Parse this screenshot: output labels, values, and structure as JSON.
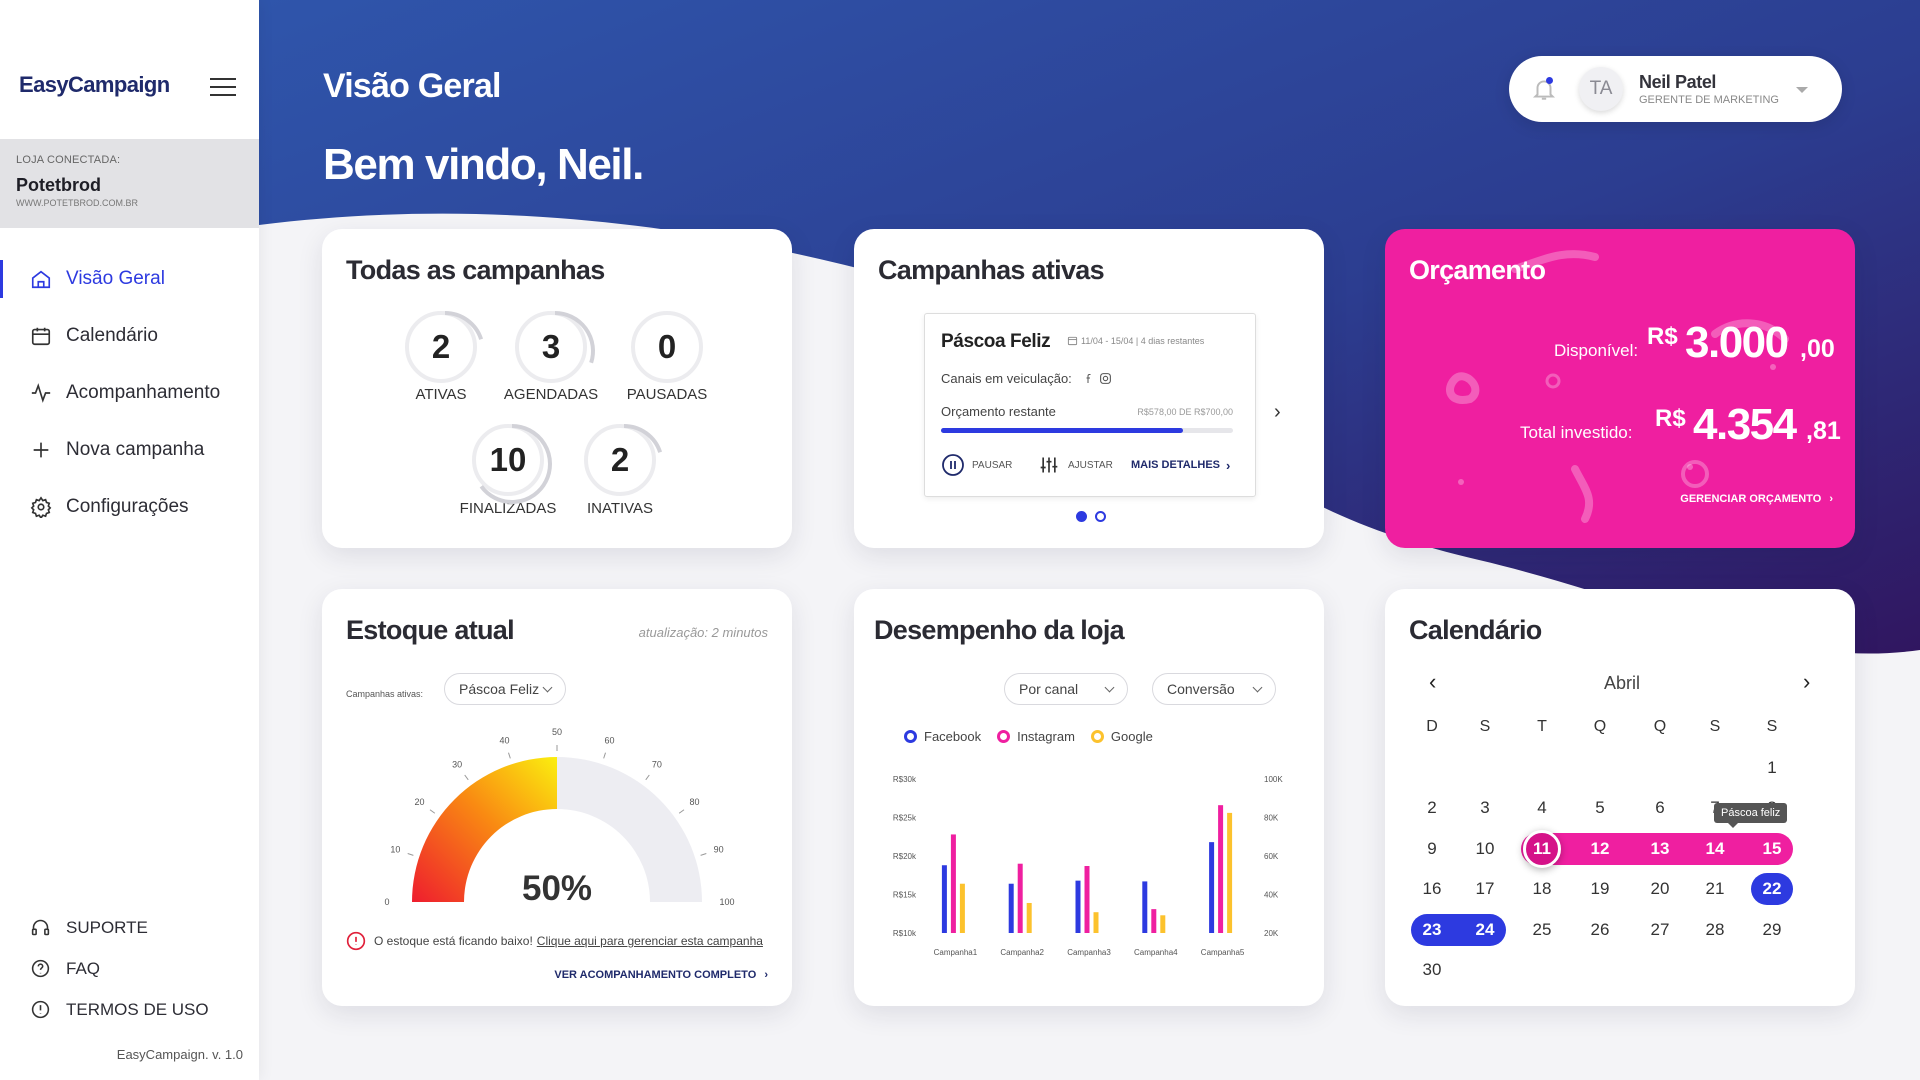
{
  "sidebar": {
    "logo": "EasyCampaign",
    "store_label": "LOJA CONECTADA:",
    "store_name": "Potetbrod",
    "store_url": "WWW.POTETBROD.COM.BR",
    "items": [
      {
        "label": "Visão Geral",
        "icon": "home-icon",
        "active": true
      },
      {
        "label": "Calendário",
        "icon": "calendar-icon"
      },
      {
        "label": "Acompanhamento",
        "icon": "activity-icon"
      },
      {
        "label": "Nova campanha",
        "icon": "plus-icon"
      },
      {
        "label": "Configurações",
        "icon": "gear-icon"
      }
    ],
    "footer": [
      {
        "label": "SUPORTE",
        "icon": "headset-icon"
      },
      {
        "label": "FAQ",
        "icon": "question-icon"
      },
      {
        "label": "TERMOS DE USO",
        "icon": "info-icon"
      }
    ],
    "version": "EasyCampaign. v. 1.0"
  },
  "header": {
    "title": "Visão Geral",
    "welcome": "Bem vindo, Neil.",
    "avatar_initials": "TA",
    "user_name": "Neil Patel",
    "user_role": "GERENTE DE MARKETING"
  },
  "all_campaigns": {
    "title": "Todas as campanhas",
    "stats": [
      {
        "value": "2",
        "label": "ATIVAS",
        "progress": 0.2
      },
      {
        "value": "3",
        "label": "AGENDADAS",
        "progress": 0.3
      },
      {
        "value": "0",
        "label": "PAUSADAS",
        "progress": 0
      },
      {
        "value": "10",
        "label": "FINALIZADAS",
        "progress": 0.65
      },
      {
        "value": "2",
        "label": "INATIVAS",
        "progress": 0.2
      }
    ]
  },
  "active_campaigns": {
    "title": "Campanhas ativas",
    "name": "Páscoa Feliz",
    "dates": "11/04 - 15/04 | 4 dias restantes",
    "channels_label": "Canais em veiculação:",
    "budget_label": "Orçamento restante",
    "budget_value": "R$578,00 DE R$700,00",
    "budget_progress": 0.83,
    "pause_label": "PAUSAR",
    "adjust_label": "AJUSTAR",
    "details_label": "MAIS DETALHES"
  },
  "budget": {
    "title": "Orçamento",
    "available_label": "Disponível:",
    "currency": "R$",
    "available_int": "3.000",
    "available_cents": ",00",
    "invested_label": "Total investido:",
    "invested_int": "4.354",
    "invested_cents": ",81",
    "manage_label": "GERENCIAR ORÇAMENTO",
    "color": "#ef1fa0"
  },
  "stock": {
    "title": "Estoque atual",
    "updated": "atualização: 2 minutos",
    "select_label": "Campanhas ativas:",
    "select_value": "Páscoa Feliz",
    "gauge_value": "50%",
    "gauge_level": 0.5,
    "gauge_ticks": [
      "0",
      "10",
      "20",
      "30",
      "40",
      "50",
      "60",
      "70",
      "80",
      "90",
      "100"
    ],
    "alert_text": "O estoque está ficando baixo!",
    "alert_link": "Clique aqui para gerenciar esta campanha",
    "full_link": "VER ACOMPANHAMENTO COMPLETO"
  },
  "performance": {
    "title": "Desempenho da loja",
    "filter1": "Por canal",
    "filter2": "Conversão"
  },
  "chart_data": {
    "type": "bar",
    "categories": [
      "Campanha1",
      "Campanha2",
      "Campanha3",
      "Campanha4",
      "Campanha5"
    ],
    "series": [
      {
        "name": "Facebook",
        "color": "#2d3ae0",
        "values": [
          18800,
          16400,
          16800,
          16700,
          21800
        ]
      },
      {
        "name": "Instagram",
        "color": "#ef1fa0",
        "values": [
          22800,
          19000,
          18700,
          13100,
          26600
        ]
      },
      {
        "name": "Google",
        "color": "#fcc22d",
        "values": [
          16400,
          13900,
          12700,
          12300,
          25600
        ]
      }
    ],
    "y_left_ticks": [
      "R$10k",
      "R$15k",
      "R$20k",
      "R$25k",
      "R$30k"
    ],
    "y_right_ticks": [
      "20K",
      "40K",
      "60K",
      "80K",
      "100K"
    ],
    "ylim": [
      10000,
      30000
    ]
  },
  "calendar": {
    "title": "Calendário",
    "month": "Abril",
    "weekdays": [
      "D",
      "S",
      "T",
      "Q",
      "Q",
      "S",
      "S"
    ],
    "days": [
      "1",
      "2",
      "3",
      "4",
      "5",
      "6",
      "7",
      "8",
      "9",
      "10",
      "11",
      "12",
      "13",
      "14",
      "15",
      "16",
      "17",
      "18",
      "19",
      "20",
      "21",
      "22",
      "23",
      "24",
      "25",
      "26",
      "27",
      "28",
      "29",
      "30"
    ],
    "tooltip": "Páscoa feliz",
    "pink_range": [
      11,
      15
    ],
    "blue_range": [
      22,
      24
    ],
    "today": 11
  }
}
